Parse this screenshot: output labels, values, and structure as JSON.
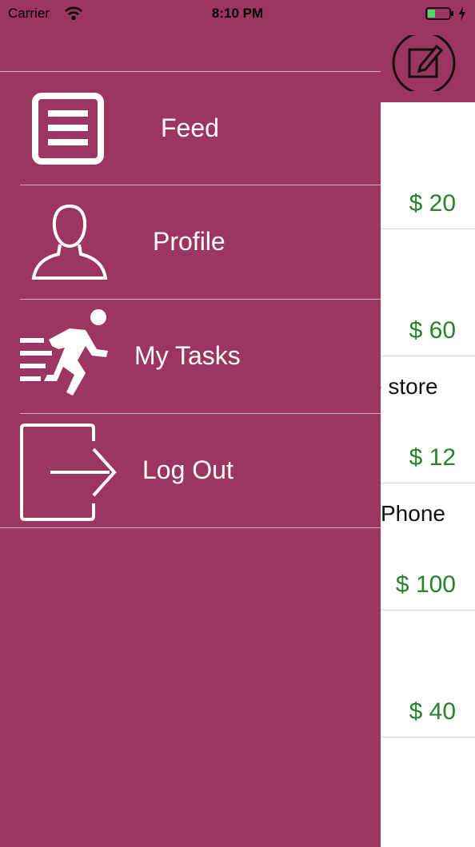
{
  "status_bar": {
    "carrier": "Carrier",
    "time": "8:10 PM",
    "battery_color": "#4cd964"
  },
  "nav": {
    "compose_icon": "compose-icon"
  },
  "menu": {
    "items": [
      {
        "label": "Feed",
        "icon": "feed-icon"
      },
      {
        "label": "Profile",
        "icon": "profile-icon"
      },
      {
        "label": "My Tasks",
        "icon": "running-icon"
      },
      {
        "label": "Log Out",
        "icon": "logout-icon"
      }
    ]
  },
  "tasks": [
    {
      "title": "",
      "price": "$ 20"
    },
    {
      "title": "",
      "price": "$ 60"
    },
    {
      "title": "e store",
      "price": "$ 12"
    },
    {
      "title": "Phone",
      "price": "$ 100"
    },
    {
      "title": "",
      "price": "$ 40"
    }
  ],
  "colors": {
    "accent": "#9c3562",
    "price": "#26822b",
    "white": "#ffffff"
  }
}
